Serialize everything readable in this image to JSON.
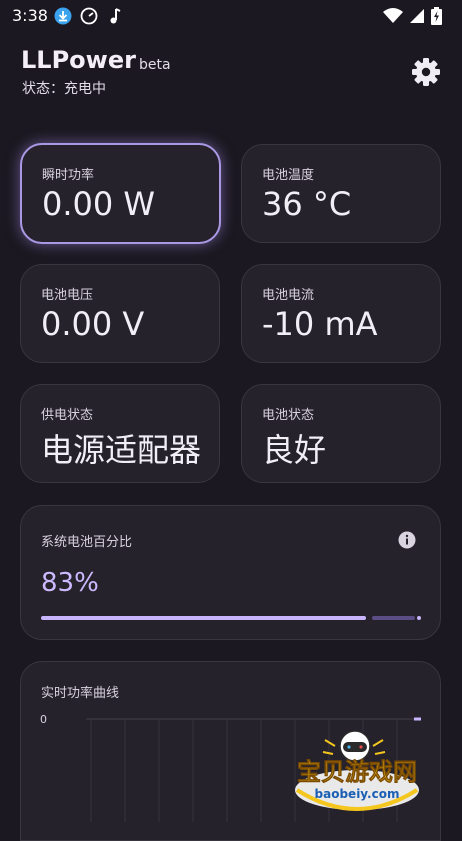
{
  "status_bar": {
    "time": "3:38",
    "left_icons": [
      "download-icon",
      "speedometer-icon",
      "music-note-icon"
    ],
    "right_icons": [
      "wifi-icon",
      "signal-icon",
      "battery-charging-icon"
    ]
  },
  "header": {
    "title": "LLPower",
    "badge": "beta",
    "status_text": "状态：充电中"
  },
  "metrics": [
    {
      "label": "瞬时功率",
      "value": "0.00 W",
      "selected": true
    },
    {
      "label": "电池温度",
      "value": "36 °C"
    },
    {
      "label": "电池电压",
      "value": "0.00 V"
    },
    {
      "label": "电池电流",
      "value": "-10 mA"
    },
    {
      "label": "供电状态",
      "value": "电源适配器"
    },
    {
      "label": "电池状态",
      "value": "良好"
    }
  ],
  "battery_percent": {
    "label": "系统电池百分比",
    "value_text": "83%",
    "level": 0.83
  },
  "power_chart": {
    "label": "实时功率曲线",
    "y_tick": "0"
  },
  "chart_data": {
    "type": "line",
    "title": "实时功率曲线",
    "y_ticks": [
      "0"
    ],
    "series": [
      {
        "values": [
          0
        ]
      }
    ],
    "grid": true
  },
  "watermark": {
    "text": "宝贝游戏网",
    "domain": "baobeiy.com"
  },
  "colors": {
    "background": "#1b1821",
    "card": "#25222b",
    "accent": "#c9b5ff",
    "selected_border": "#a999e5"
  }
}
